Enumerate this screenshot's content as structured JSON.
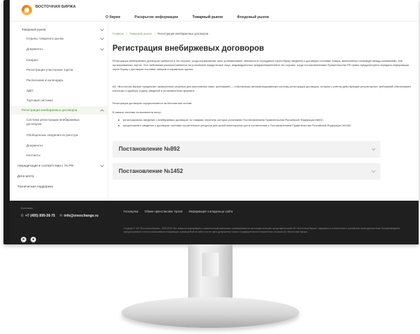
{
  "header": {
    "logo_text": "ВОСТОЧНАЯ БИРЖА",
    "nav": [
      "О бирже",
      "Раскрытие информации",
      "Товарный рынок",
      "Фондовый рынок"
    ]
  },
  "sidebar": {
    "items": [
      {
        "label": "Товарный рынок",
        "level": 0,
        "chevron": "down"
      },
      {
        "label": "Отделы товарного рынка",
        "level": 1,
        "chevron": "down"
      },
      {
        "label": "Документы",
        "level": 1,
        "chevron": "down"
      },
      {
        "label": "Клиринг",
        "level": 1
      },
      {
        "label": "Регистрация участников торгов",
        "level": 1
      },
      {
        "label": "Расписание и календарь",
        "level": 1
      },
      {
        "label": "ЭДО",
        "level": 1
      },
      {
        "label": "Торговая система",
        "level": 1
      },
      {
        "label": "Регистрация внебиржевых договоров",
        "level": 0,
        "chevron": "up",
        "active": true
      },
      {
        "label": "Система регистрации внебиржевых договоров",
        "level": 1
      },
      {
        "label": "Обобщенные сведения из реестра",
        "level": 1
      },
      {
        "label": "Документы",
        "level": 1
      },
      {
        "label": "Контакты",
        "level": 1
      },
      {
        "label": "Аккредитация в соответствии с ГК РФ",
        "level": 0,
        "chevron": "down"
      },
      {
        "label": "Дата-центр",
        "level": 0
      },
      {
        "label": "Техническая поддержка",
        "level": 0
      }
    ]
  },
  "main": {
    "breadcrumb": [
      "Главная",
      "Товарный рынок",
      "Регистрация внебиржевых договоров"
    ],
    "title": "Регистрация внебиржевых договоров",
    "paragraphs": [
      "Регистрация внебиржевых договоров требуется в тех случаях, когда нормативные акты устанавливают обязанность передавать через биржу сведения о договорах поставки товара, заключенных напрямую между компаниями, вне организованных торгов. Эти требования распространяются на российские юридические лица, индивидуальных предпринимателей в тех случаях, когда постановлениями Правительства РФ прямо предусмотрена передача информации через биржу о договорах поставки товаров и параметры сделки.",
      "АО «Восточная биржа» предлагает проверенное решение для выполнения таких требований — собственную автоматизированную систему регистрации договоров, которая с учётом действующих регуляторных требований обеспечивает понятную и удобную подачу сведений в установленном формате.",
      "Регистрация договоров осуществляется на бесплатной основе.",
      "В рамках системы пользователи могут:"
    ],
    "bullets": [
      "регистрировать сведения о внебиржевых договорах по товарам, перечень которых установлен Постановлением Правительства Российской Федерации №892;",
      "предоставлять сведения о договорах поставки строительных ресурсов для целей мониторинга цен в соответствии с Постановлением Правительства Российской Федерации №1452."
    ],
    "accordions": [
      "Постановление №892",
      "Постановление №1452"
    ]
  },
  "footer": {
    "contacts_label": "Контакты",
    "phone": "+7 (495) 899-38-75",
    "email": "info@onexchange.ru",
    "links": [
      "Госзакупки",
      "Обмен приостановок торгов",
      "Информация о владельце сайта"
    ],
    "copyright": "Copyright © АО «Восточная Биржа», 1999-2025. Все права на информацию и аналитические материалы, размещённые на настоящем интернет-представительстве АО «Восточная биржа», защищены в соответствии с российским законодательством. Воспроизведение, распространение и иное использование информации, размещённой на сайте или ее части допускается только с предварительного письменного согласия АО «Восточная биржа»."
  }
}
